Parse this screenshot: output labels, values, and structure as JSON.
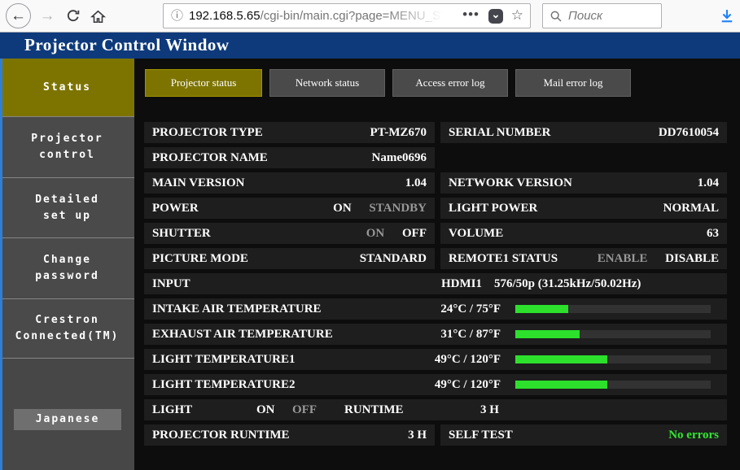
{
  "browser": {
    "url_host": "192.168.5.65",
    "url_path": "/cgi-bin/main.cgi?page=MENU_STAT",
    "search_placeholder": "Поиск"
  },
  "header": {
    "title": "Projector Control Window"
  },
  "sidebar": {
    "status": {
      "line1": "Status"
    },
    "projector_control": {
      "line1": "Projector",
      "line2": "control"
    },
    "detailed_setup": {
      "line1": "Detailed",
      "line2": "set up"
    },
    "change_password": {
      "line1": "Change",
      "line2": "password"
    },
    "crestron": {
      "line1": "Crestron",
      "line2": "Connected(TM)"
    },
    "language_button": "Japanese"
  },
  "tabs": {
    "projector_status": "Projector status",
    "network_status": "Network status",
    "access_error_log": "Access error log",
    "mail_error_log": "Mail error log"
  },
  "status_rows": {
    "projector_type": {
      "label": "PROJECTOR TYPE",
      "value": "PT-MZ670"
    },
    "serial_number": {
      "label": "SERIAL NUMBER",
      "value": "DD7610054"
    },
    "projector_name": {
      "label": "PROJECTOR NAME",
      "value": "Name0696"
    },
    "main_version": {
      "label": "MAIN VERSION",
      "value": "1.04"
    },
    "network_version": {
      "label": "NETWORK VERSION",
      "value": "1.04"
    },
    "power": {
      "label": "POWER",
      "on": "ON",
      "standby": "STANDBY",
      "state": "ON"
    },
    "light_power": {
      "label": "LIGHT POWER",
      "value": "NORMAL"
    },
    "shutter": {
      "label": "SHUTTER",
      "on": "ON",
      "off": "OFF",
      "state": "OFF"
    },
    "volume": {
      "label": "VOLUME",
      "value": "63"
    },
    "picture_mode": {
      "label": "PICTURE MODE",
      "value": "STANDARD"
    },
    "remote1_status": {
      "label": "REMOTE1 STATUS",
      "enable": "ENABLE",
      "disable": "DISABLE",
      "state": "DISABLE"
    },
    "input": {
      "label": "INPUT",
      "source": "HDMI1",
      "signal": "576/50p (31.25kHz/50.02Hz)"
    },
    "intake_air_temperature": {
      "label": "INTAKE AIR TEMPERATURE",
      "value": "24°C / 75°F",
      "bar_percent": 27
    },
    "exhaust_air_temperature": {
      "label": "EXHAUST AIR TEMPERATURE",
      "value": "31°C / 87°F",
      "bar_percent": 33
    },
    "light_temperature1": {
      "label": "LIGHT TEMPERATURE1",
      "value": "49°C / 120°F",
      "bar_percent": 47
    },
    "light_temperature2": {
      "label": "LIGHT TEMPERATURE2",
      "value": "49°C / 120°F",
      "bar_percent": 47
    },
    "light": {
      "label": "LIGHT",
      "on": "ON",
      "off": "OFF",
      "state": "ON",
      "runtime_label": "RUNTIME",
      "runtime_value": "3 H"
    },
    "projector_runtime": {
      "label": "PROJECTOR RUNTIME",
      "value": "3 H"
    },
    "self_test": {
      "label": "SELF TEST",
      "value": "No errors"
    }
  },
  "colors": {
    "header_blue": "#0e3a7c",
    "accent_olive": "#7d7400",
    "panel_gray": "#4a4a4a",
    "row_background": "#1e1e1e",
    "bar_green": "#2ce02c",
    "ok_text_green": "#33e633",
    "disabled_text_gray": "#989898",
    "edge_blue": "#2f7fd6",
    "download_blue": "#2284f7"
  }
}
